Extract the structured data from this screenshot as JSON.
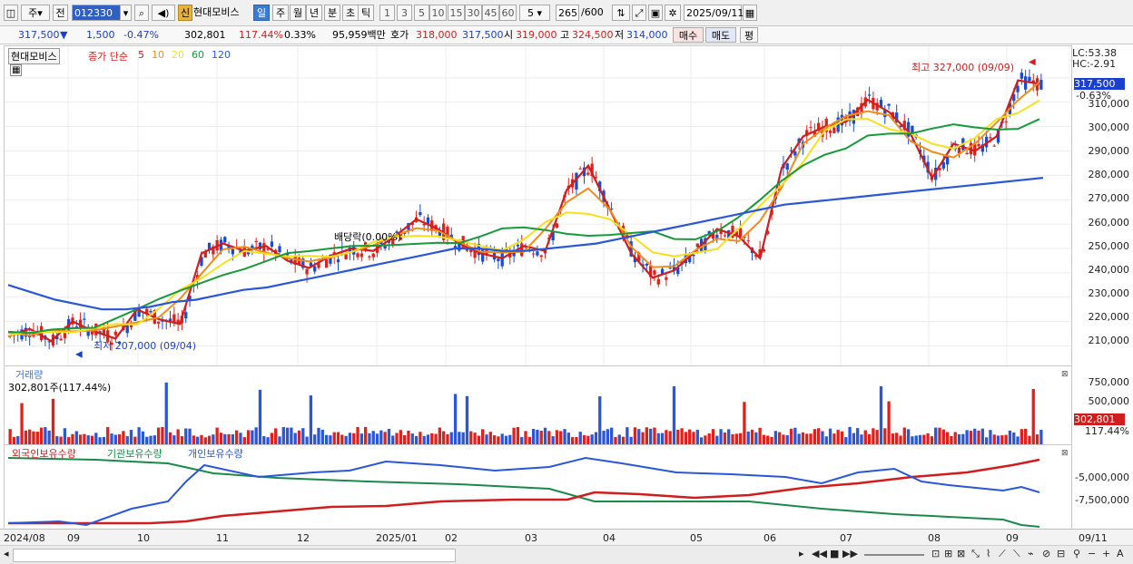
{
  "toolbar": {
    "period_label": "주",
    "prev_label": "전",
    "stock_code": "012330",
    "badge_new": "신",
    "stock_name": "현대모비스",
    "period_tabs": [
      "일",
      "주",
      "월",
      "년",
      "분",
      "초",
      "틱"
    ],
    "active_period": "일",
    "interval_buttons": [
      "1",
      "3",
      "5",
      "10",
      "15",
      "30",
      "45",
      "60"
    ],
    "interval_value": "5",
    "count_value": "265",
    "count_total": "/600",
    "date_value": "2025/09/11"
  },
  "infobar": {
    "price": "317,500",
    "change_arrow": "▼",
    "change": "1,500",
    "change_pct": "-0.47%",
    "volume": "302,801",
    "volume_ratio": "117.44%",
    "turnover": "0.33%",
    "trade_value": "95,959백만",
    "hoga_label": "호가",
    "ask": "318,000",
    "bid": "317,500",
    "open_label": "시",
    "open": "319,000",
    "high_label": "고",
    "high": "324,500",
    "low_label": "저",
    "low": "314,000",
    "buy_button": "매수",
    "sell_button": "매도",
    "eval_button": "평"
  },
  "price_panel": {
    "name_label": "현대모비스",
    "ma_label": "종가 단순",
    "ma_periods": [
      "5",
      "10",
      "20",
      "60",
      "120"
    ],
    "ma_colors": [
      "#d11d1d",
      "#f08c1a",
      "#f5e11b",
      "#179a3a",
      "#2a56d8"
    ],
    "lc_label": "LC:53.38",
    "hc_label": "HC:-2.91",
    "last_price_tag": "317,500",
    "last_change_tag": "-0.63%",
    "max_annotation": "최고 327,000 (09/09)",
    "min_annotation": "최저 207,000 (09/04)",
    "dividend_annotation": "배당락(0.00%)",
    "y_ticks": [
      "310,000",
      "300,000",
      "290,000",
      "280,000",
      "270,000",
      "260,000",
      "250,000",
      "240,000",
      "230,000",
      "220,000",
      "210,000"
    ]
  },
  "volume_panel": {
    "title": "거래량",
    "value_label": "302,801주(117.44%)",
    "y_ticks": [
      "750,000",
      "500,000",
      "250,000"
    ],
    "last_tag": "302,801",
    "last_pct": "117.44%"
  },
  "holding_panel": {
    "legend": [
      "외국인보유수량",
      "기관보유수량",
      "개인보유수량"
    ],
    "colors": [
      "#d11d1d",
      "#1a8a4a",
      "#2a56d8"
    ],
    "y_ticks": [
      "-5,000,000",
      "-7,500,000"
    ]
  },
  "xaxis": {
    "labels": [
      "2024/08",
      "09",
      "10",
      "11",
      "12",
      "2025/01",
      "02",
      "03",
      "04",
      "05",
      "06",
      "07",
      "08",
      "09"
    ],
    "right_date": "09/11"
  },
  "chart_data": [
    {
      "type": "candlestick",
      "title": "현대모비스",
      "y_unit": "KRW",
      "ylim": [
        202000,
        333000
      ],
      "x_start": "2024/08",
      "x_end": "2025/09/11",
      "series": [
        {
          "name": "5",
          "values": [
            214000,
            217000,
            212000,
            220000,
            216000,
            213000,
            225000,
            221000,
            219000,
            248000,
            252000,
            249000,
            251000,
            245000,
            242000,
            247000,
            250000,
            249000,
            255000,
            262000,
            258000,
            252000,
            248000,
            246000,
            251000,
            249000,
            274000,
            284000,
            266000,
            248000,
            238000,
            241000,
            249000,
            258000,
            255000,
            246000,
            283000,
            296000,
            300000,
            302000,
            311000,
            306000,
            297000,
            279000,
            293000,
            290000,
            296000,
            319000,
            317500
          ]
        },
        {
          "name": "120",
          "values": [
            235000,
            232000,
            229000,
            227000,
            225000,
            225000,
            226000,
            228000,
            229000,
            231000,
            233000,
            234000,
            236000,
            238000,
            240000,
            242000,
            244000,
            246000,
            248000,
            250000,
            250000,
            249000,
            249000,
            250000,
            251000,
            252000,
            254000,
            256000,
            258000,
            260000,
            262000,
            264000,
            266000,
            268000,
            269000,
            270000,
            271000,
            272000,
            273000,
            274000,
            275000,
            276000,
            277000,
            278000,
            279000
          ]
        }
      ]
    }
  ]
}
